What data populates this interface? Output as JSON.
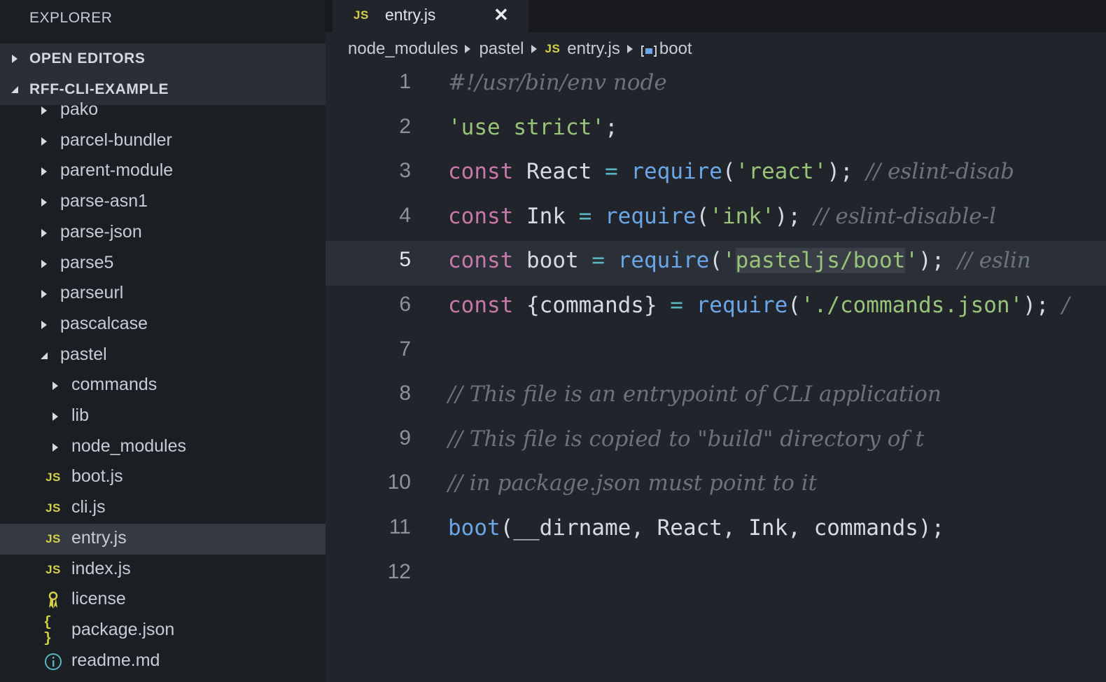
{
  "sidebar": {
    "title": "EXPLORER",
    "open_editors": "OPEN EDITORS",
    "project": "RFF-CLI-EXAMPLE",
    "items": [
      {
        "label": "pako",
        "kind": "folder",
        "state": "closed",
        "depth": 1
      },
      {
        "label": "parcel-bundler",
        "kind": "folder",
        "state": "closed",
        "depth": 1
      },
      {
        "label": "parent-module",
        "kind": "folder",
        "state": "closed",
        "depth": 1
      },
      {
        "label": "parse-asn1",
        "kind": "folder",
        "state": "closed",
        "depth": 1
      },
      {
        "label": "parse-json",
        "kind": "folder",
        "state": "closed",
        "depth": 1
      },
      {
        "label": "parse5",
        "kind": "folder",
        "state": "closed",
        "depth": 1
      },
      {
        "label": "parseurl",
        "kind": "folder",
        "state": "closed",
        "depth": 1
      },
      {
        "label": "pascalcase",
        "kind": "folder",
        "state": "closed",
        "depth": 1
      },
      {
        "label": "pastel",
        "kind": "folder",
        "state": "open",
        "depth": 1
      },
      {
        "label": "commands",
        "kind": "folder",
        "state": "closed",
        "depth": 2
      },
      {
        "label": "lib",
        "kind": "folder",
        "state": "closed",
        "depth": 2
      },
      {
        "label": "node_modules",
        "kind": "folder",
        "state": "closed",
        "depth": 2
      },
      {
        "label": "boot.js",
        "kind": "js",
        "depth": 2
      },
      {
        "label": "cli.js",
        "kind": "js",
        "depth": 2
      },
      {
        "label": "entry.js",
        "kind": "js",
        "depth": 2,
        "selected": true
      },
      {
        "label": "index.js",
        "kind": "js",
        "depth": 2
      },
      {
        "label": "license",
        "kind": "license",
        "depth": 2
      },
      {
        "label": "package.json",
        "kind": "json",
        "depth": 2
      },
      {
        "label": "readme.md",
        "kind": "info",
        "depth": 2
      }
    ],
    "js_badge": "JS",
    "json_badge": "{}"
  },
  "tab": {
    "label": "entry.js",
    "close": "✕",
    "badge": "JS"
  },
  "breadcrumb": {
    "parts": [
      "node_modules",
      "pastel",
      "entry.js",
      "boot"
    ]
  },
  "code": {
    "lines": [
      {
        "n": "1",
        "tokens": [
          [
            "cm",
            "#!/usr/bin/env node"
          ]
        ]
      },
      {
        "n": "2",
        "tokens": [
          [
            "str",
            "'use strict'"
          ],
          [
            "id",
            ";"
          ]
        ]
      },
      {
        "n": "3",
        "tokens": [
          [
            "kw",
            "const"
          ],
          [
            "id",
            " React "
          ],
          [
            "op",
            "="
          ],
          [
            "id",
            " "
          ],
          [
            "fn",
            "require"
          ],
          [
            "id",
            "("
          ],
          [
            "str",
            "'react'"
          ],
          [
            "id",
            "); "
          ],
          [
            "cm",
            "// eslint-disab"
          ]
        ]
      },
      {
        "n": "4",
        "tokens": [
          [
            "kw",
            "const"
          ],
          [
            "id",
            " Ink "
          ],
          [
            "op",
            "="
          ],
          [
            "id",
            " "
          ],
          [
            "fn",
            "require"
          ],
          [
            "id",
            "("
          ],
          [
            "str",
            "'ink'"
          ],
          [
            "id",
            "); "
          ],
          [
            "cm",
            "// eslint-disable-l"
          ]
        ]
      },
      {
        "n": "5",
        "current": true,
        "tokens": [
          [
            "kw",
            "const"
          ],
          [
            "id",
            " boot "
          ],
          [
            "op",
            "="
          ],
          [
            "id",
            " "
          ],
          [
            "fn",
            "require"
          ],
          [
            "id",
            "("
          ],
          [
            "str",
            "'"
          ],
          [
            "strhl",
            "pasteljs/boot"
          ],
          [
            "str",
            "'"
          ],
          [
            "id",
            "); "
          ],
          [
            "cm",
            "// eslin"
          ]
        ]
      },
      {
        "n": "6",
        "tokens": [
          [
            "kw",
            "const"
          ],
          [
            "id",
            " {commands} "
          ],
          [
            "op",
            "="
          ],
          [
            "id",
            " "
          ],
          [
            "fn",
            "require"
          ],
          [
            "id",
            "("
          ],
          [
            "str",
            "'./commands.json'"
          ],
          [
            "id",
            "); "
          ],
          [
            "cm",
            "/"
          ]
        ]
      },
      {
        "n": "7",
        "tokens": []
      },
      {
        "n": "8",
        "tokens": [
          [
            "cm",
            "// This file is an entrypoint of CLI application"
          ]
        ]
      },
      {
        "n": "9",
        "tokens": [
          [
            "cm",
            "// This file is copied to \"build\" directory of t"
          ]
        ]
      },
      {
        "n": "10",
        "tokens": [
          [
            "cm",
            "// in package.json must point to it"
          ]
        ]
      },
      {
        "n": "11",
        "tokens": [
          [
            "fn",
            "boot"
          ],
          [
            "id",
            "(__dirname, React, Ink, commands);"
          ]
        ]
      },
      {
        "n": "12",
        "tokens": []
      }
    ]
  }
}
